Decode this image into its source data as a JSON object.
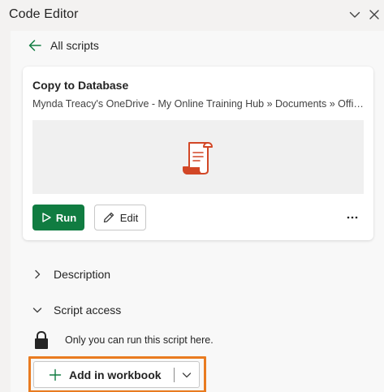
{
  "pane": {
    "title": "Code Editor",
    "collapse_icon": "chevron-down-icon",
    "close_icon": "close-icon"
  },
  "back_link": {
    "label": "All scripts",
    "icon": "arrow-left-icon"
  },
  "script": {
    "name": "Copy to Database",
    "path": "Mynda Treacy's OneDrive - My Online Training Hub » Documents » Office S...",
    "thumbnail_icon": "script-scroll-icon",
    "run_label": "Run",
    "edit_label": "Edit",
    "more_icon": "more-horizontal-icon"
  },
  "sections": {
    "description": {
      "label": "Description",
      "icon": "chevron-right-icon",
      "expanded": false
    },
    "script_access": {
      "label": "Script access",
      "icon": "chevron-down-icon",
      "expanded": true
    }
  },
  "access": {
    "note": "Only you can run this script here.",
    "icon": "lock-icon"
  },
  "add_button": {
    "label": "Add in workbook",
    "icon": "plus-icon",
    "dropdown_icon": "chevron-down-icon"
  },
  "colors": {
    "accent_green": "#107c41",
    "focus_orange": "#e97b20",
    "script_icon_red": "#d24726"
  }
}
